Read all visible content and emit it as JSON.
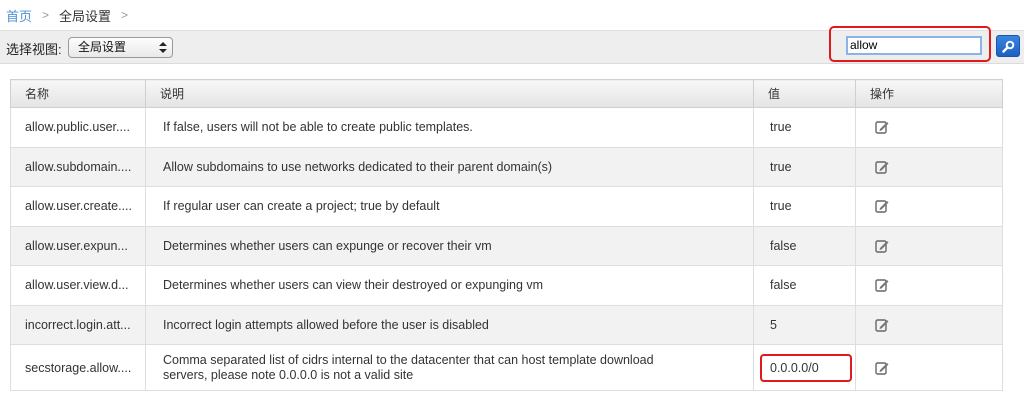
{
  "breadcrumb": {
    "home": "首页",
    "separator": ">",
    "current": "全局设置"
  },
  "toolbar": {
    "view_label": "选择视图:",
    "view_select_value": "全局设置",
    "search_value": "allow",
    "search_button_icon": "search-icon"
  },
  "table": {
    "columns": [
      "名称",
      "说明",
      "值",
      "操作"
    ],
    "rows": [
      {
        "name": "allow.public.user....",
        "description": "If false, users will not be able to create public templates.",
        "value": "true",
        "action_icon": "edit-icon"
      },
      {
        "name": "allow.subdomain....",
        "description": "Allow subdomains to use networks dedicated to their parent domain(s)",
        "value": "true",
        "action_icon": "edit-icon"
      },
      {
        "name": "allow.user.create....",
        "description": "If regular user can create a project; true by default",
        "value": "true",
        "action_icon": "edit-icon"
      },
      {
        "name": "allow.user.expun...",
        "description": "Determines whether users can expunge or recover their vm",
        "value": "false",
        "action_icon": "edit-icon"
      },
      {
        "name": "allow.user.view.d...",
        "description": "Determines whether users can view their destroyed or expunging vm",
        "value": "false",
        "action_icon": "edit-icon"
      },
      {
        "name": "incorrect.login.att...",
        "description": "Incorrect login attempts allowed before the user is disabled",
        "value": "5",
        "action_icon": "edit-icon"
      },
      {
        "name": "secstorage.allow....",
        "description_line1": "Comma separated list of cidrs internal to the datacenter that can host template download",
        "description_line2": "servers, please note 0.0.0.0 is not a valid site",
        "value": "0.0.0.0/0",
        "action_icon": "edit-icon"
      }
    ]
  },
  "colors": {
    "link": "#4a8fd6",
    "highlight": "#e0191c",
    "search_button": "#1c5fc4"
  }
}
